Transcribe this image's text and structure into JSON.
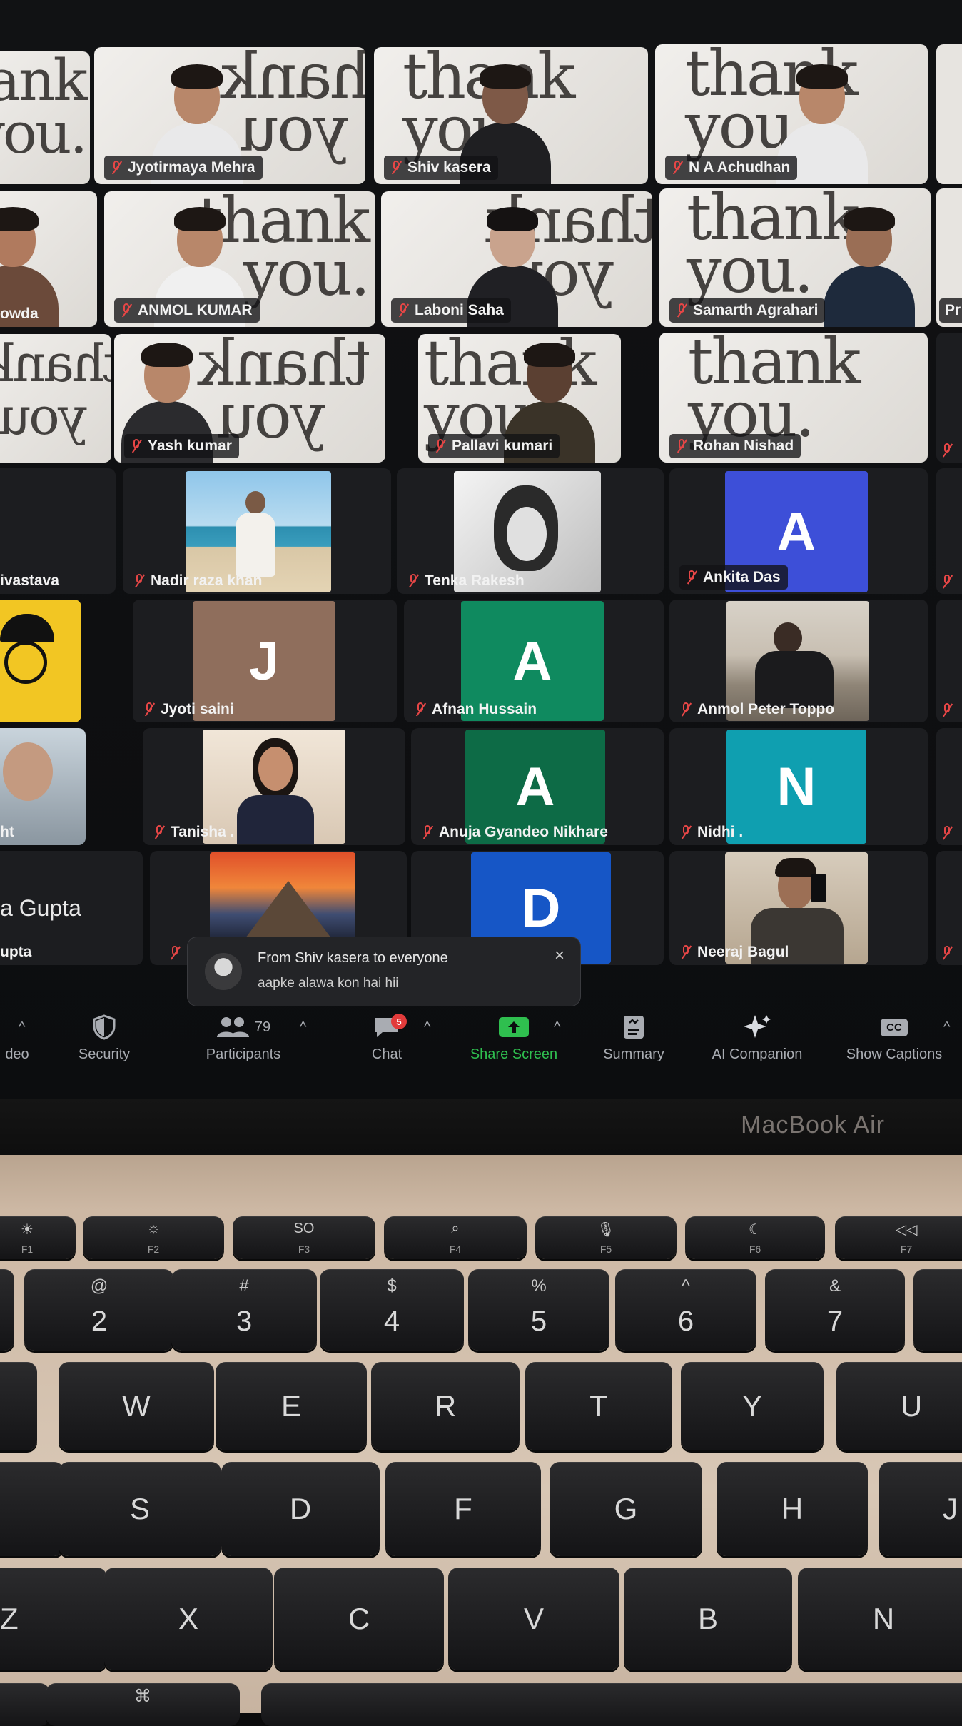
{
  "meeting": {
    "participants": [
      {
        "name": "Jyotirmaya Mehra",
        "video": "thank_you_background"
      },
      {
        "name": "Shiv kasera",
        "video": "thank_you_background"
      },
      {
        "name": "N A Achudhan",
        "video": "thank_you_background"
      },
      {
        "name": "ANMOL KUMAR",
        "video": "thank_you_background"
      },
      {
        "name": "Laboni Saha",
        "video": "thank_you_background"
      },
      {
        "name": "Samarth Agrahari",
        "video": "thank_you_background"
      },
      {
        "name": "Yash kumar",
        "video": "thank_you_background"
      },
      {
        "name": "Pallavi kumari",
        "video": "thank_you_background"
      },
      {
        "name": "Rohan Nishad",
        "video": "thank_you_background"
      },
      {
        "name": "Nadir raza khan",
        "video": "photo"
      },
      {
        "name": "Tenka Rakesh",
        "video": "photo"
      },
      {
        "name": "Ankita Das",
        "avatar_letter": "A",
        "avatar_color": "#3d4fd8"
      },
      {
        "name": "Jyoti saini",
        "avatar_letter": "J",
        "avatar_color": "#8f6e5c"
      },
      {
        "name": "Afnan Hussain",
        "avatar_letter": "A",
        "avatar_color": "#0f8a5f"
      },
      {
        "name": "Anmol Peter Toppo",
        "video": "photo"
      },
      {
        "name": "Tanisha .",
        "video": "photo"
      },
      {
        "name": "Anuja Gyandeo Nikhare",
        "avatar_letter": "A",
        "avatar_color": "#0d6b46"
      },
      {
        "name": "Nidhi .",
        "avatar_letter": "N",
        "avatar_color": "#0f9fb0"
      },
      {
        "name": "D",
        "avatar_letter": "D",
        "avatar_color": "#1656c6"
      },
      {
        "name": "Neeraj Bagul",
        "video": "photo"
      }
    ],
    "partial_names": [
      "owda",
      "ivastava",
      "ht",
      "a Gupta",
      "upta",
      "Pr"
    ],
    "thank_you_text": "thank\nyou.",
    "thank_you_mirrored_text": "thank\nyou."
  },
  "chat_toast": {
    "from": "From Shiv kasera to everyone",
    "message": "aapke alawa kon hai hii",
    "close_glyph": "×"
  },
  "toolbar": {
    "video_partial_label": "deo",
    "security_label": "Security",
    "participants_label": "Participants",
    "participants_count": "79",
    "chat_label": "Chat",
    "chat_badge": "5",
    "share_label": "Share Screen",
    "summary_label": "Summary",
    "ai_label": "AI Companion",
    "captions_label": "Show Captions",
    "captions_icon_text": "CC",
    "caret": "^",
    "colors": {
      "label": "#a9acb2",
      "share": "#2fbf4f",
      "badge": "#e23b3b"
    }
  },
  "laptop": {
    "brand": "MacBook Air"
  },
  "keyboard": {
    "fn_row": [
      {
        "sym": "☀",
        "label": "F1"
      },
      {
        "sym": "☼",
        "label": "F2"
      },
      {
        "sym": "SO",
        "label": "F3"
      },
      {
        "sym": "⌕",
        "label": "F4"
      },
      {
        "sym": "🎙",
        "label": "F5"
      },
      {
        "sym": "☾",
        "label": "F6"
      },
      {
        "sym": "◁◁",
        "label": "F7"
      }
    ],
    "number_row": [
      {
        "sym": "@",
        "label": "2"
      },
      {
        "sym": "#",
        "label": "3"
      },
      {
        "sym": "$",
        "label": "4"
      },
      {
        "sym": "%",
        "label": "5"
      },
      {
        "sym": "^",
        "label": "6"
      },
      {
        "sym": "&",
        "label": "7"
      }
    ],
    "qwerty_row": [
      "W",
      "E",
      "R",
      "T",
      "Y",
      "U"
    ],
    "home_row": [
      "S",
      "D",
      "F",
      "G",
      "H",
      "J"
    ],
    "bottom_row": [
      "Z",
      "X",
      "C",
      "V",
      "B",
      "N"
    ],
    "command_glyph": "⌘"
  }
}
